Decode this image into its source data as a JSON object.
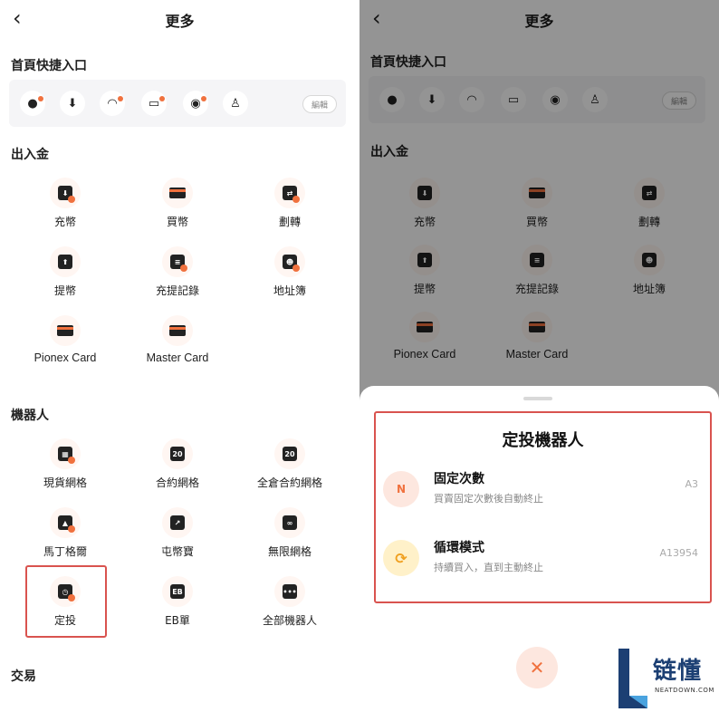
{
  "left": {
    "nav_title": "更多",
    "quick_title": "首頁快捷入口",
    "quick_icons": [
      "person-icon",
      "deposit-icon",
      "support-icon",
      "card-icon",
      "bot-icon",
      "trophy-icon"
    ],
    "edit_label": "編輯",
    "sections": {
      "funds": {
        "title": "出入金",
        "items": [
          {
            "label": "充幣",
            "icon": "deposit-icon"
          },
          {
            "label": "買幣",
            "icon": "card-icon"
          },
          {
            "label": "劃轉",
            "icon": "transfer-icon"
          },
          {
            "label": "提幣",
            "icon": "withdraw-icon"
          },
          {
            "label": "充提記錄",
            "icon": "history-icon"
          },
          {
            "label": "地址簿",
            "icon": "address-book-icon"
          },
          {
            "label": "Pionex Card",
            "icon": "card-icon"
          },
          {
            "label": "Master Card",
            "icon": "card-icon"
          }
        ]
      },
      "bots": {
        "title": "機器人",
        "items": [
          {
            "label": "現貨網格",
            "icon": "grid-icon"
          },
          {
            "label": "合約網格",
            "icon": "futures-grid-icon"
          },
          {
            "label": "全倉合約網格",
            "icon": "cross-grid-icon"
          },
          {
            "label": "馬丁格爾",
            "icon": "martingale-icon"
          },
          {
            "label": "屯幣寶",
            "icon": "chart-icon"
          },
          {
            "label": "無限網格",
            "icon": "infinity-icon"
          },
          {
            "label": "定投",
            "icon": "clock-icon"
          },
          {
            "label": "EB單",
            "icon": "eb-icon"
          },
          {
            "label": "全部機器人",
            "icon": "more-icon"
          }
        ]
      },
      "trade": {
        "title": "交易"
      }
    }
  },
  "right": {
    "sheet_title": "定投機器人",
    "options": [
      {
        "name": "固定次數",
        "desc": "買賣固定次數後自動終止",
        "count": "A3",
        "icon_text": "N",
        "icon": "fixed-count-icon"
      },
      {
        "name": "循環模式",
        "desc": "持續買入，直到主動終止",
        "count": "A13954",
        "icon_text": "⟳",
        "icon": "loop-icon"
      }
    ],
    "close_icon": "close-icon",
    "watermark": {
      "title": "链懂",
      "subtitle": "NEATDOWN.COM"
    }
  },
  "colors": {
    "accent": "#f0713e",
    "highlight": "#d9534f",
    "brand_blue": "#1c3f73"
  }
}
